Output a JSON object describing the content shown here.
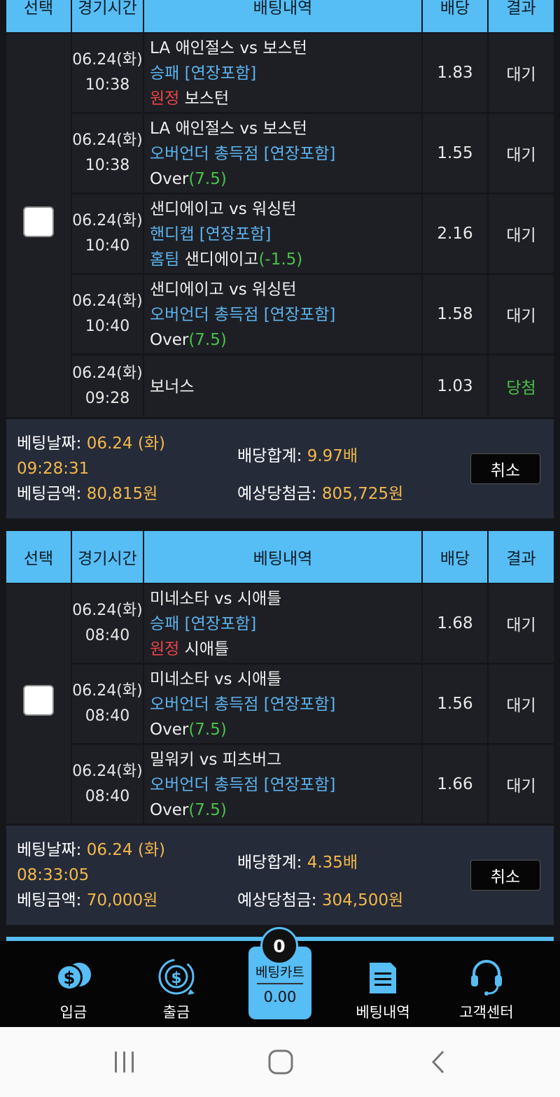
{
  "columns": {
    "select": "선택",
    "time": "경기시간",
    "bet": "베팅내역",
    "odds": "배당",
    "result": "결과"
  },
  "top_header_partial": {
    "select": "선택",
    "time": "경기시간",
    "bet": "배팅내역",
    "odds": "배당",
    "result": "결과"
  },
  "slip1": {
    "rows": [
      {
        "date": "06.24(화)",
        "time": "10:38",
        "match": "LA 애인절스 vs 보스턴",
        "market": "승패 [연장포함]",
        "pick_label": "원정",
        "pick_team": "보스턴",
        "pick_value": "",
        "odds": "1.83",
        "result": "대기"
      },
      {
        "date": "06.24(화)",
        "time": "10:38",
        "match": "LA 애인절스 vs 보스턴",
        "market": "오버언더 총득점 [연장포함]",
        "pick_label": "",
        "pick_team": "Over",
        "pick_value": "(7.5)",
        "odds": "1.55",
        "result": "대기"
      },
      {
        "date": "06.24(화)",
        "time": "10:40",
        "match": "샌디에이고 vs 워싱턴",
        "market": "핸디캡 [연장포함]",
        "pick_label": "홈팀",
        "pick_team": "샌디에이고",
        "pick_value": "(-1.5)",
        "odds": "2.16",
        "result": "대기"
      },
      {
        "date": "06.24(화)",
        "time": "10:40",
        "match": "샌디에이고 vs 워싱턴",
        "market": "오버언더 총득점 [연장포함]",
        "pick_label": "",
        "pick_team": "Over",
        "pick_value": "(7.5)",
        "odds": "1.58",
        "result": "대기"
      }
    ],
    "bonus": {
      "date": "06.24(화)",
      "time": "09:28",
      "label": "보너스",
      "odds": "1.03",
      "result": "당첨"
    },
    "summary": {
      "bet_date_label": "베팅날짜:",
      "bet_date": "06.24 (화)",
      "bet_time": "09:28:31",
      "total_odds_label": "배당합계:",
      "total_odds": "9.97배",
      "amount_label": "베팅금액:",
      "amount": "80,815원",
      "expected_label": "예상당첨금:",
      "expected": "805,725원",
      "cancel": "취소"
    }
  },
  "slip2": {
    "rows": [
      {
        "date": "06.24(화)",
        "time": "08:40",
        "match": "미네소타 vs 시애틀",
        "market": "승패 [연장포함]",
        "pick_label": "원정",
        "pick_team": "시애틀",
        "pick_value": "",
        "odds": "1.68",
        "result": "대기"
      },
      {
        "date": "06.24(화)",
        "time": "08:40",
        "match": "미네소타 vs 시애틀",
        "market": "오버언더 총득점 [연장포함]",
        "pick_label": "",
        "pick_team": "Over",
        "pick_value": "(7.5)",
        "odds": "1.56",
        "result": "대기"
      },
      {
        "date": "06.24(화)",
        "time": "08:40",
        "match": "밀워키 vs 피츠버그",
        "market": "오버언더 총득점 [연장포함]",
        "pick_label": "",
        "pick_team": "Over",
        "pick_value": "(7.5)",
        "odds": "1.66",
        "result": "대기"
      }
    ],
    "summary": {
      "bet_date_label": "베팅날짜:",
      "bet_date": "06.24 (화)",
      "bet_time": "08:33:05",
      "total_odds_label": "배당합계:",
      "total_odds": "4.35배",
      "amount_label": "베팅금액:",
      "amount": "70,000원",
      "expected_label": "예상당첨금:",
      "expected": "304,500원",
      "cancel": "취소"
    }
  },
  "tabbar": {
    "deposit": "입금",
    "withdraw": "출금",
    "cart_title": "베팅카트",
    "cart_count": "0",
    "cart_value": "0.00",
    "history": "베팅내역",
    "support": "고객센터"
  },
  "colors": {
    "header": "#56bdf5",
    "accent_value": "#f2b84b",
    "market": "#5bb4f0",
    "away": "#e84545",
    "win": "#49c24a"
  }
}
